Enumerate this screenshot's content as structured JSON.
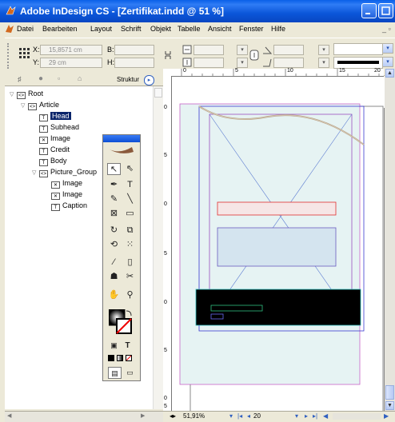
{
  "window": {
    "title": "Adobe InDesign CS - [Zertifikat.indd @ 51 %]"
  },
  "menu": [
    "Datei",
    "Bearbeiten",
    "Layout",
    "Schrift",
    "Objekt",
    "Tabelle",
    "Ansicht",
    "Fenster",
    "Hilfe"
  ],
  "control": {
    "x_label": "X:",
    "x_value": "15,8571 cm",
    "y_label": "Y:",
    "y_value": "29 cm",
    "b_label": "B:",
    "h_label": "H:"
  },
  "panel": {
    "struktur_label": "Struktur",
    "tree": [
      {
        "label": "Root",
        "level": 0,
        "expanded": true,
        "kind": "element"
      },
      {
        "label": "Article",
        "level": 1,
        "expanded": true,
        "kind": "element"
      },
      {
        "label": "Head",
        "level": 2,
        "kind": "text",
        "selected": true
      },
      {
        "label": "Subhead",
        "level": 2,
        "kind": "text"
      },
      {
        "label": "Image",
        "level": 2,
        "kind": "image"
      },
      {
        "label": "Credit",
        "level": 2,
        "kind": "text"
      },
      {
        "label": "Body",
        "level": 2,
        "kind": "text"
      },
      {
        "label": "Picture_Group",
        "level": 2,
        "expanded": true,
        "kind": "element"
      },
      {
        "label": "Image",
        "level": 3,
        "kind": "image"
      },
      {
        "label": "Image",
        "level": 3,
        "kind": "image"
      },
      {
        "label": "Caption",
        "level": 3,
        "kind": "text"
      }
    ]
  },
  "ruler": {
    "top": [
      "0",
      "5",
      "10",
      "15",
      "20"
    ],
    "left": [
      "0",
      "5",
      "0",
      "5",
      "0",
      "5",
      "0",
      "5"
    ]
  },
  "status": {
    "zoom": "51,91%",
    "page": "20"
  },
  "colors": {
    "accent": "#0a5fe8",
    "selection": "#0a246a",
    "frame_blue": "#3030ff",
    "frame_red": "#e03030"
  },
  "tools": [
    "selection-tool",
    "direct-selection-tool",
    "pen-tool",
    "type-tool",
    "pencil-tool",
    "line-tool",
    "rectangle-frame-tool",
    "rectangle-tool",
    "rotate-tool",
    "scale-tool",
    "shear-tool",
    "free-transform-tool",
    "eyedropper-tool",
    "gradient-tool",
    "button-tool",
    "scissors-tool",
    "hand-tool",
    "zoom-tool"
  ]
}
